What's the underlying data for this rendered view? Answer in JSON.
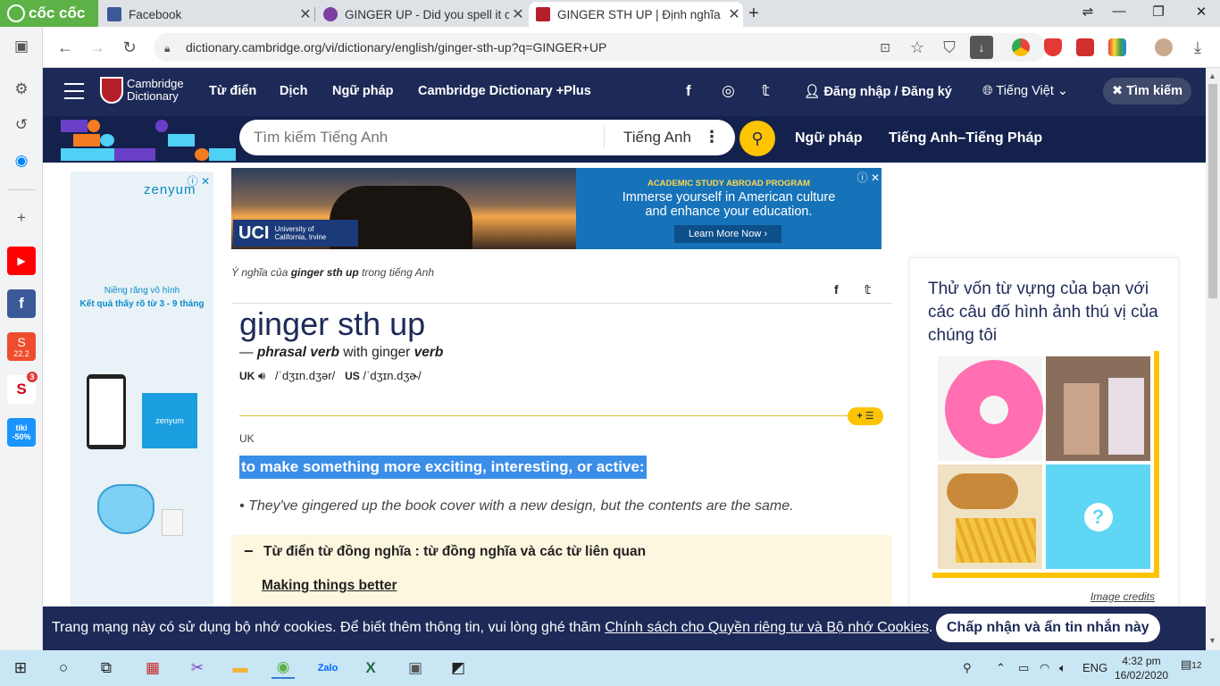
{
  "browser": {
    "brand": "cốc cốc",
    "tabs": [
      {
        "title": "Facebook"
      },
      {
        "title": "GINGER UP - Did you spell it c"
      },
      {
        "title": "GINGER STH UP | Định nghĩa"
      }
    ],
    "url": "dictionary.cambridge.org/vi/dictionary/english/ginger-sth-up?q=GINGER+UP",
    "sidebar_badges": {
      "shopee": "22.2",
      "notif": "3",
      "tiki": "-50%",
      "tiki_label": "tiki"
    }
  },
  "site": {
    "logo_line1": "Cambridge",
    "logo_line2": "Dictionary",
    "nav": [
      "Từ điển",
      "Dịch",
      "Ngữ pháp",
      "Cambridge Dictionary +Plus"
    ],
    "login": "Đăng nhập / Đăng ký",
    "language": "Tiếng Việt",
    "search_toggle": "Tìm kiếm",
    "search_placeholder": "Tìm kiếm Tiếng Anh",
    "search_lang": "Tiếng Anh",
    "subnav": [
      "Ngữ pháp",
      "Tiếng Anh–Tiếng Pháp"
    ]
  },
  "ads": {
    "left": {
      "brand": "zenyum",
      "line1": "Niềng răng vô hình",
      "line2": "Kết quả thấy rõ từ 3 - 9 tháng",
      "box": "zenyum"
    },
    "top": {
      "headline": "ACADEMIC STUDY ABROAD PROGRAM",
      "text1": "Immerse yourself in American culture",
      "text2": "and enhance your education.",
      "cta": "Learn More Now",
      "uci": "UCI",
      "uci_sub1": "University of",
      "uci_sub2": "California, Irvine"
    }
  },
  "entry": {
    "breadcrumb_pre": "Ý nghĩa của ",
    "breadcrumb_word": "ginger sth up",
    "breadcrumb_post": " trong tiếng Anh",
    "headword": "ginger sth up",
    "dash": "— ",
    "pos": "phrasal verb",
    "with_text": " with ginger ",
    "pos2": "verb",
    "uk_label": "UK",
    "uk_ipa": "/ˈdʒɪn.dʒər/",
    "us_label": "US",
    "us_ipa": "/ˈdʒɪn.dʒɚ/",
    "region": "UK",
    "definition": "to make something more exciting, interesting, or active:",
    "example": "They've gingered up the book cover with a new design, but the contents are the same.",
    "synonyms_title": "Từ điển từ đồng nghĩa : từ đồng nghĩa và các từ liên quan",
    "synonyms_link": "Making things better"
  },
  "quiz": {
    "question": "Thử vốn từ vựng của bạn với các câu đố hình ảnh thú vị của chúng tôi",
    "credits": "Image credits",
    "mystery": "?"
  },
  "cookie": {
    "text": "Trang mạng này có sử dụng bộ nhớ cookies. Để biết thêm thông tin, vui lòng ghé thăm ",
    "link": "Chính sách cho Quyền riêng tư và Bộ nhớ Cookies",
    "end": ".",
    "accept": "Chấp nhận và ẩn tin nhắn này"
  },
  "taskbar": {
    "lang": "ENG",
    "time": "4:32 pm",
    "date": "16/02/2020",
    "notif": "12"
  },
  "colors": {
    "header": "#1d2a57",
    "accent": "#fec400",
    "highlight": "#3b8ee8"
  }
}
